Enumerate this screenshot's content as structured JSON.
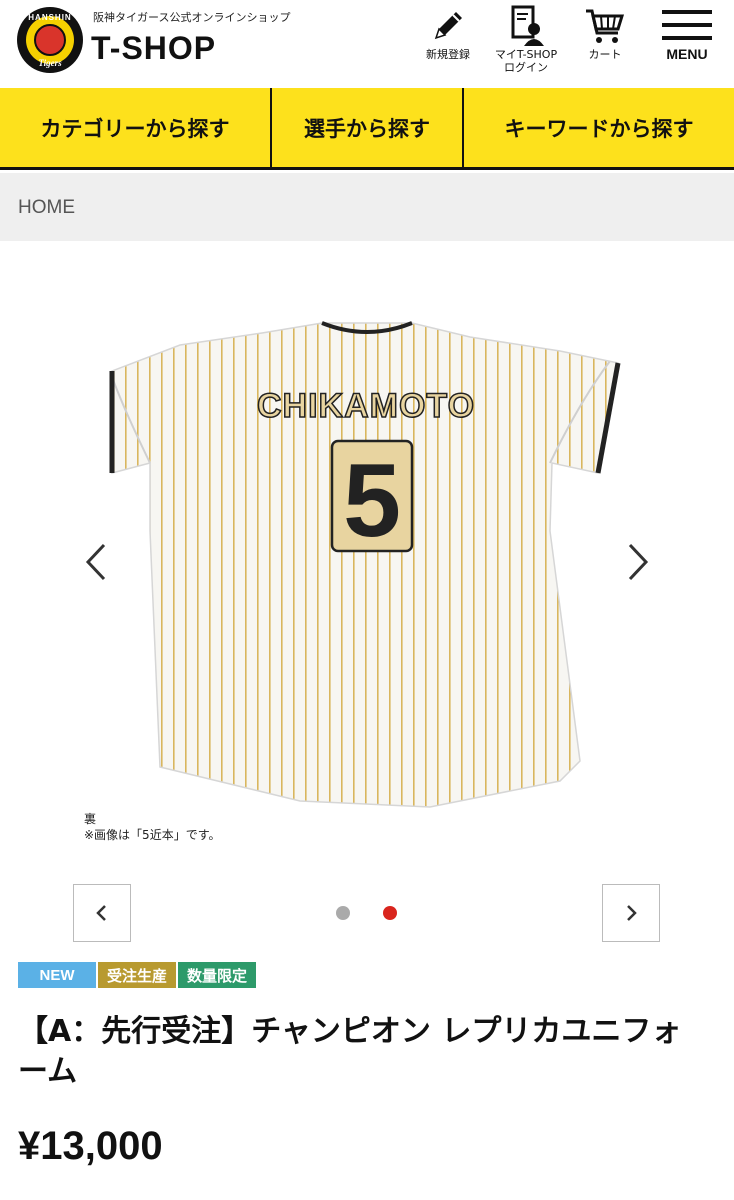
{
  "header": {
    "logo_ring_text": "HANSHIN",
    "logo_ring_text2": "Tigers",
    "shop_sub": "阪神タイガース公式オンラインショップ",
    "shop_name": "T-SHOP",
    "register_label": "新規登録",
    "mypage_label_1": "マイT-SHOP",
    "mypage_label_2": "ログイン",
    "cart_label": "カート",
    "menu_label": "MENU"
  },
  "nav": {
    "items": [
      {
        "label": "カテゴリーから探す"
      },
      {
        "label": "選手から探す"
      },
      {
        "label": "キーワードから探す"
      }
    ]
  },
  "breadcrumb": {
    "home": "HOME"
  },
  "product_image": {
    "jersey_name": "CHIKAMOTO",
    "jersey_number": "5",
    "caption_line1": "裏",
    "caption_line2": "※画像は「5近本」です。"
  },
  "carousel": {
    "active_index": 2,
    "total": 2,
    "dot_inactive_color": "#aaaaaa",
    "dot_active_color": "#d9251d"
  },
  "product": {
    "badges": [
      {
        "label": "NEW",
        "color": "#5bb1e6"
      },
      {
        "label": "受注生産",
        "color": "#b89a30"
      },
      {
        "label": "数量限定",
        "color": "#2d9a6a"
      }
    ],
    "title": "【A：先行受注】チャンピオン レプリカユニフォーム",
    "price": "¥13,000"
  },
  "colors": {
    "nav_yellow": "#fde11c",
    "breadcrumb_bg": "#efefef"
  }
}
